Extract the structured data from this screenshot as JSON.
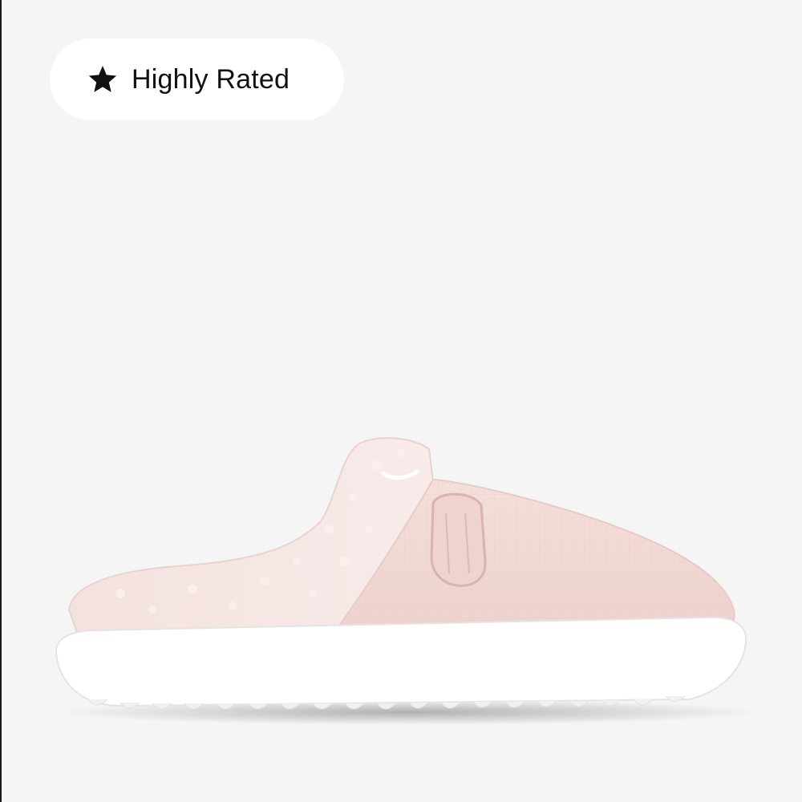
{
  "badge": {
    "icon": "star-icon",
    "label": "Highly Rated"
  },
  "product": {
    "image": "pink-fleece-slide-slipper",
    "colors": {
      "upper": "#f3dcd8",
      "lining": "#f6e4e2",
      "sole": "#ffffff",
      "background": "#f5f5f5"
    }
  }
}
